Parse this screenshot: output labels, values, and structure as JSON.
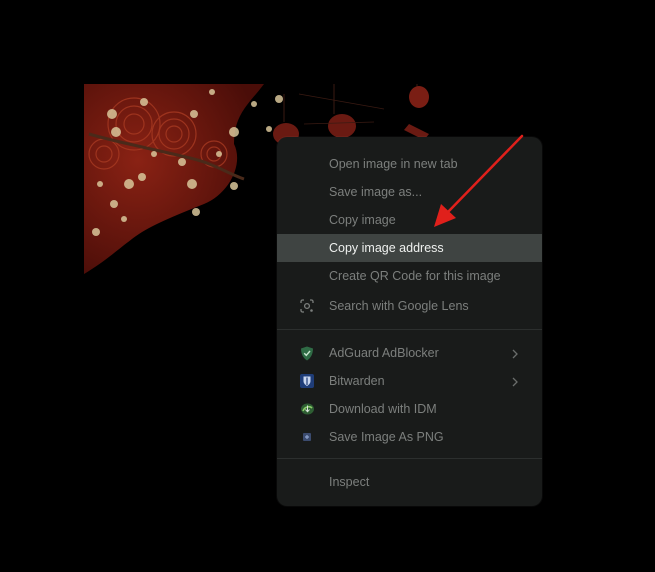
{
  "context_menu": {
    "items": [
      {
        "label": "Open image in new tab"
      },
      {
        "label": "Save image as..."
      },
      {
        "label": "Copy image"
      },
      {
        "label": "Copy image address"
      },
      {
        "label": "Create QR Code for this image"
      },
      {
        "label": "Search with Google Lens",
        "icon": "google-lens-icon"
      }
    ],
    "extensions": [
      {
        "label": "AdGuard AdBlocker",
        "icon": "adguard-shield-icon",
        "submenu": true
      },
      {
        "label": "Bitwarden",
        "icon": "bitwarden-icon",
        "submenu": true
      },
      {
        "label": "Download with IDM",
        "icon": "idm-icon",
        "submenu": false
      },
      {
        "label": "Save Image As PNG",
        "icon": "save-png-icon",
        "submenu": false
      }
    ],
    "inspect": {
      "label": "Inspect"
    },
    "highlighted_item": "Copy image address"
  },
  "colors": {
    "page_background": "#000000",
    "menu_background": "#191b1a",
    "menu_highlight": "#3f4442",
    "menu_text": "#7c7f7d",
    "menu_text_highlight": "#eef0ee",
    "annotation_arrow": "#e0201b",
    "artwork_red": "#7a1a10"
  }
}
